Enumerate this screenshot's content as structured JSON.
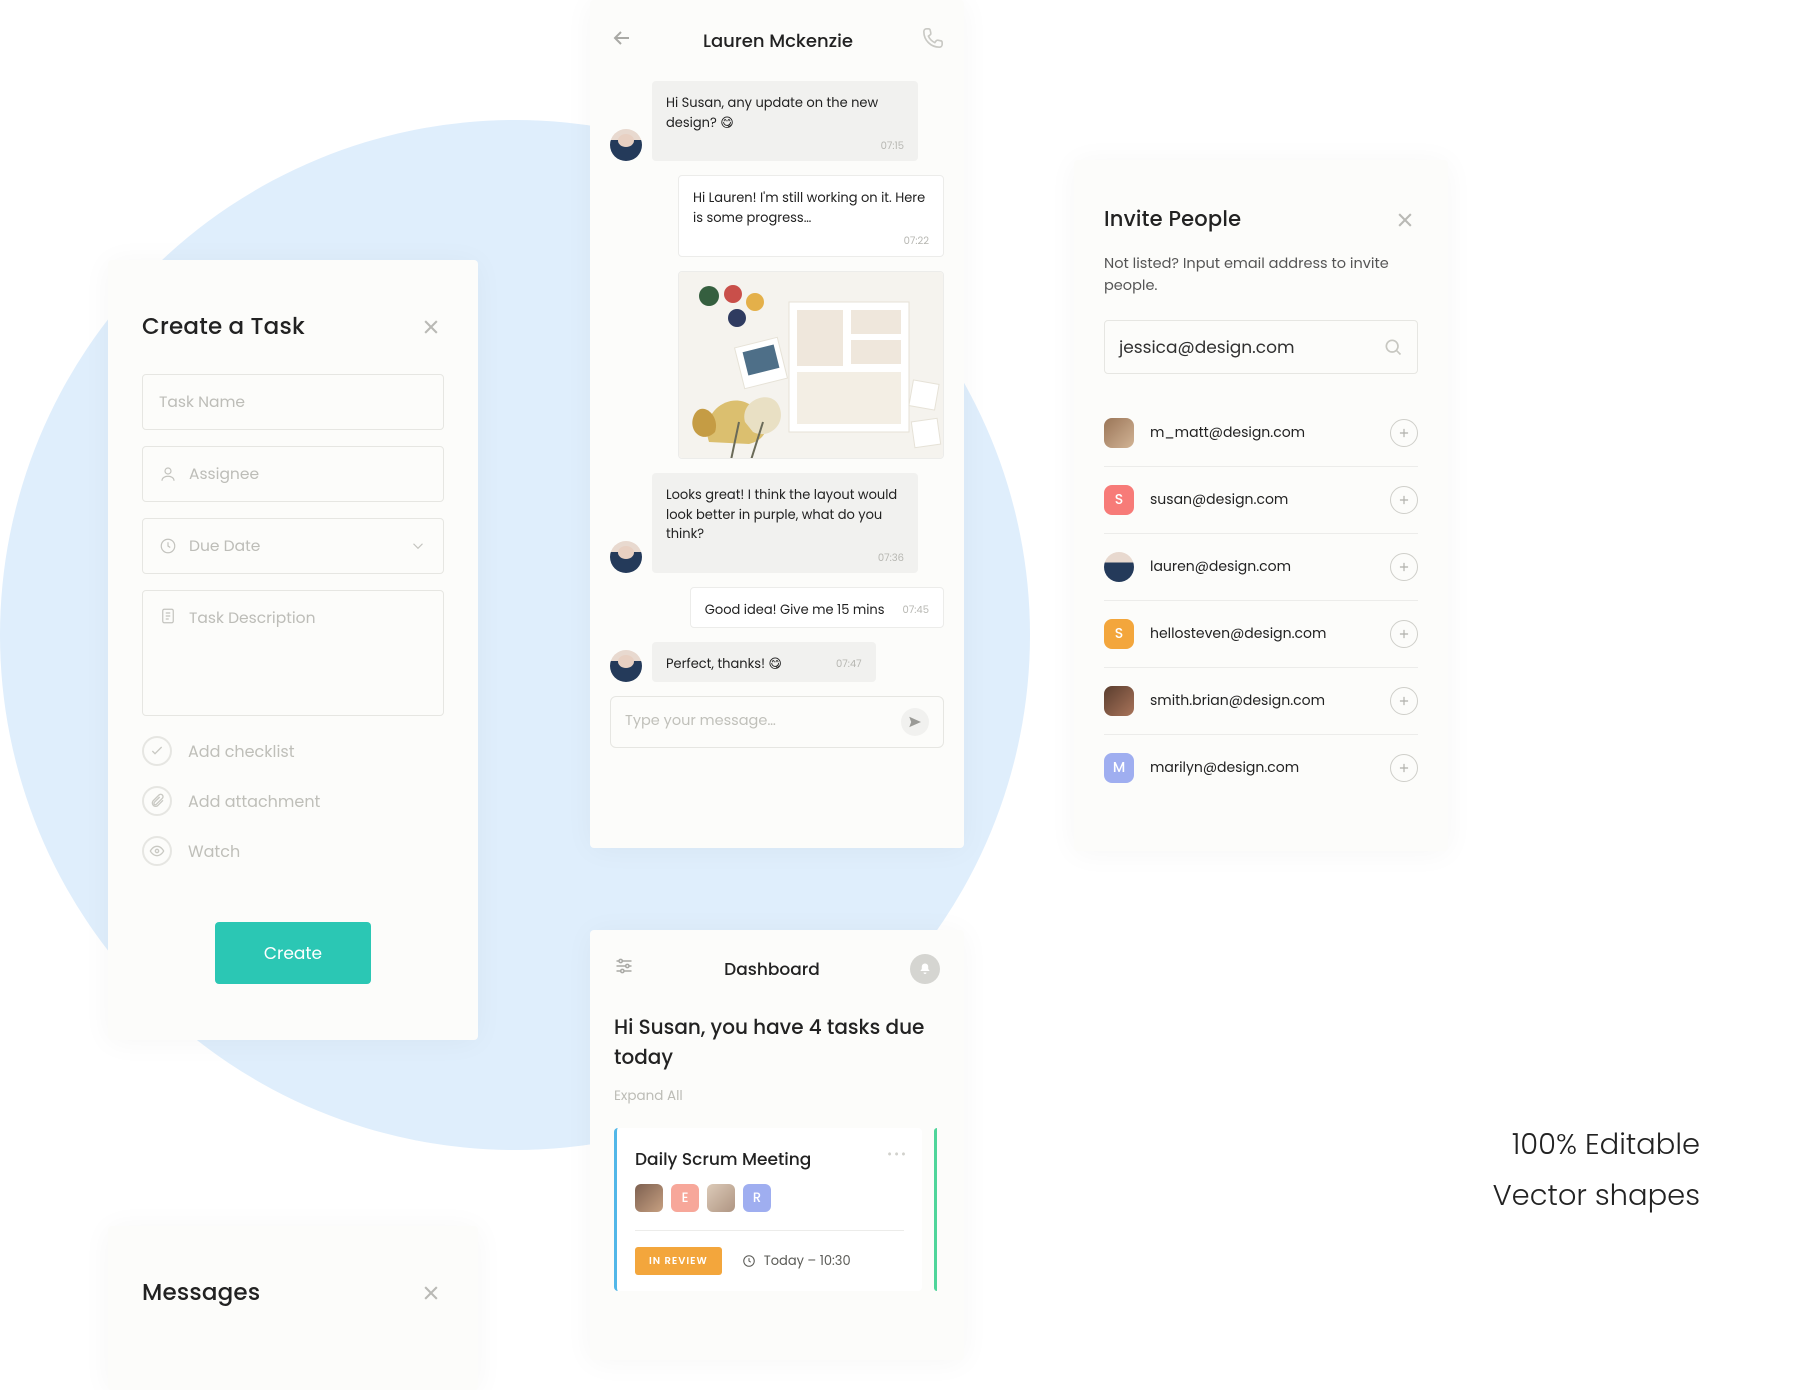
{
  "create_task": {
    "title": "Create a Task",
    "fields": {
      "name_ph": "Task Name",
      "assignee_ph": "Assignee",
      "due_ph": "Due Date",
      "desc_ph": "Task Description"
    },
    "options": {
      "checklist": "Add checklist",
      "attachment": "Add attachment",
      "watch": "Watch"
    },
    "submit": "Create"
  },
  "messages_panel": {
    "title": "Messages"
  },
  "chat": {
    "contact": "Lauren Mckenzie",
    "messages": [
      {
        "side": "left",
        "text": "Hi Susan, any update on the new design? 😋",
        "time": "07:15"
      },
      {
        "side": "right",
        "text": "Hi Lauren! I'm still working on it. Here is some progress…",
        "time": "07:22"
      },
      {
        "side": "right",
        "image": true
      },
      {
        "side": "left",
        "text": "Looks great! I think the layout would look better in purple, what do you think?",
        "time": "07:36"
      },
      {
        "side": "right",
        "text": "Good idea! Give me 15 mins",
        "time": "07:45"
      },
      {
        "side": "left",
        "text": "Perfect, thanks! 😋",
        "time": "07:47"
      }
    ],
    "composer_ph": "Type your message…"
  },
  "dashboard": {
    "title": "Dashboard",
    "greeting": "Hi Susan, you have 4 tasks due today",
    "expand": "Expand All",
    "task": {
      "title": "Daily Scrum Meeting",
      "people_letters": {
        "e": "E",
        "r": "R"
      },
      "status": "IN REVIEW",
      "due": "Today – 10:30"
    }
  },
  "invite": {
    "title": "Invite People",
    "hint": "Not listed? Input email address to invite people.",
    "search_value": "jessica@design.com",
    "people": [
      {
        "avatar": "photo1",
        "email": "m_matt@design.com"
      },
      {
        "avatar": "l-s",
        "letter": "S",
        "email": "susan@design.com"
      },
      {
        "avatar": "photo2",
        "email": "lauren@design.com"
      },
      {
        "avatar": "l-s2",
        "letter": "S",
        "email": "hellosteven@design.com"
      },
      {
        "avatar": "photo3",
        "email": "smith.brian@design.com"
      },
      {
        "avatar": "l-m",
        "letter": "M",
        "email": "marilyn@design.com"
      }
    ]
  },
  "marketing": {
    "line1": "100% Editable",
    "line2": "Vector shapes"
  }
}
